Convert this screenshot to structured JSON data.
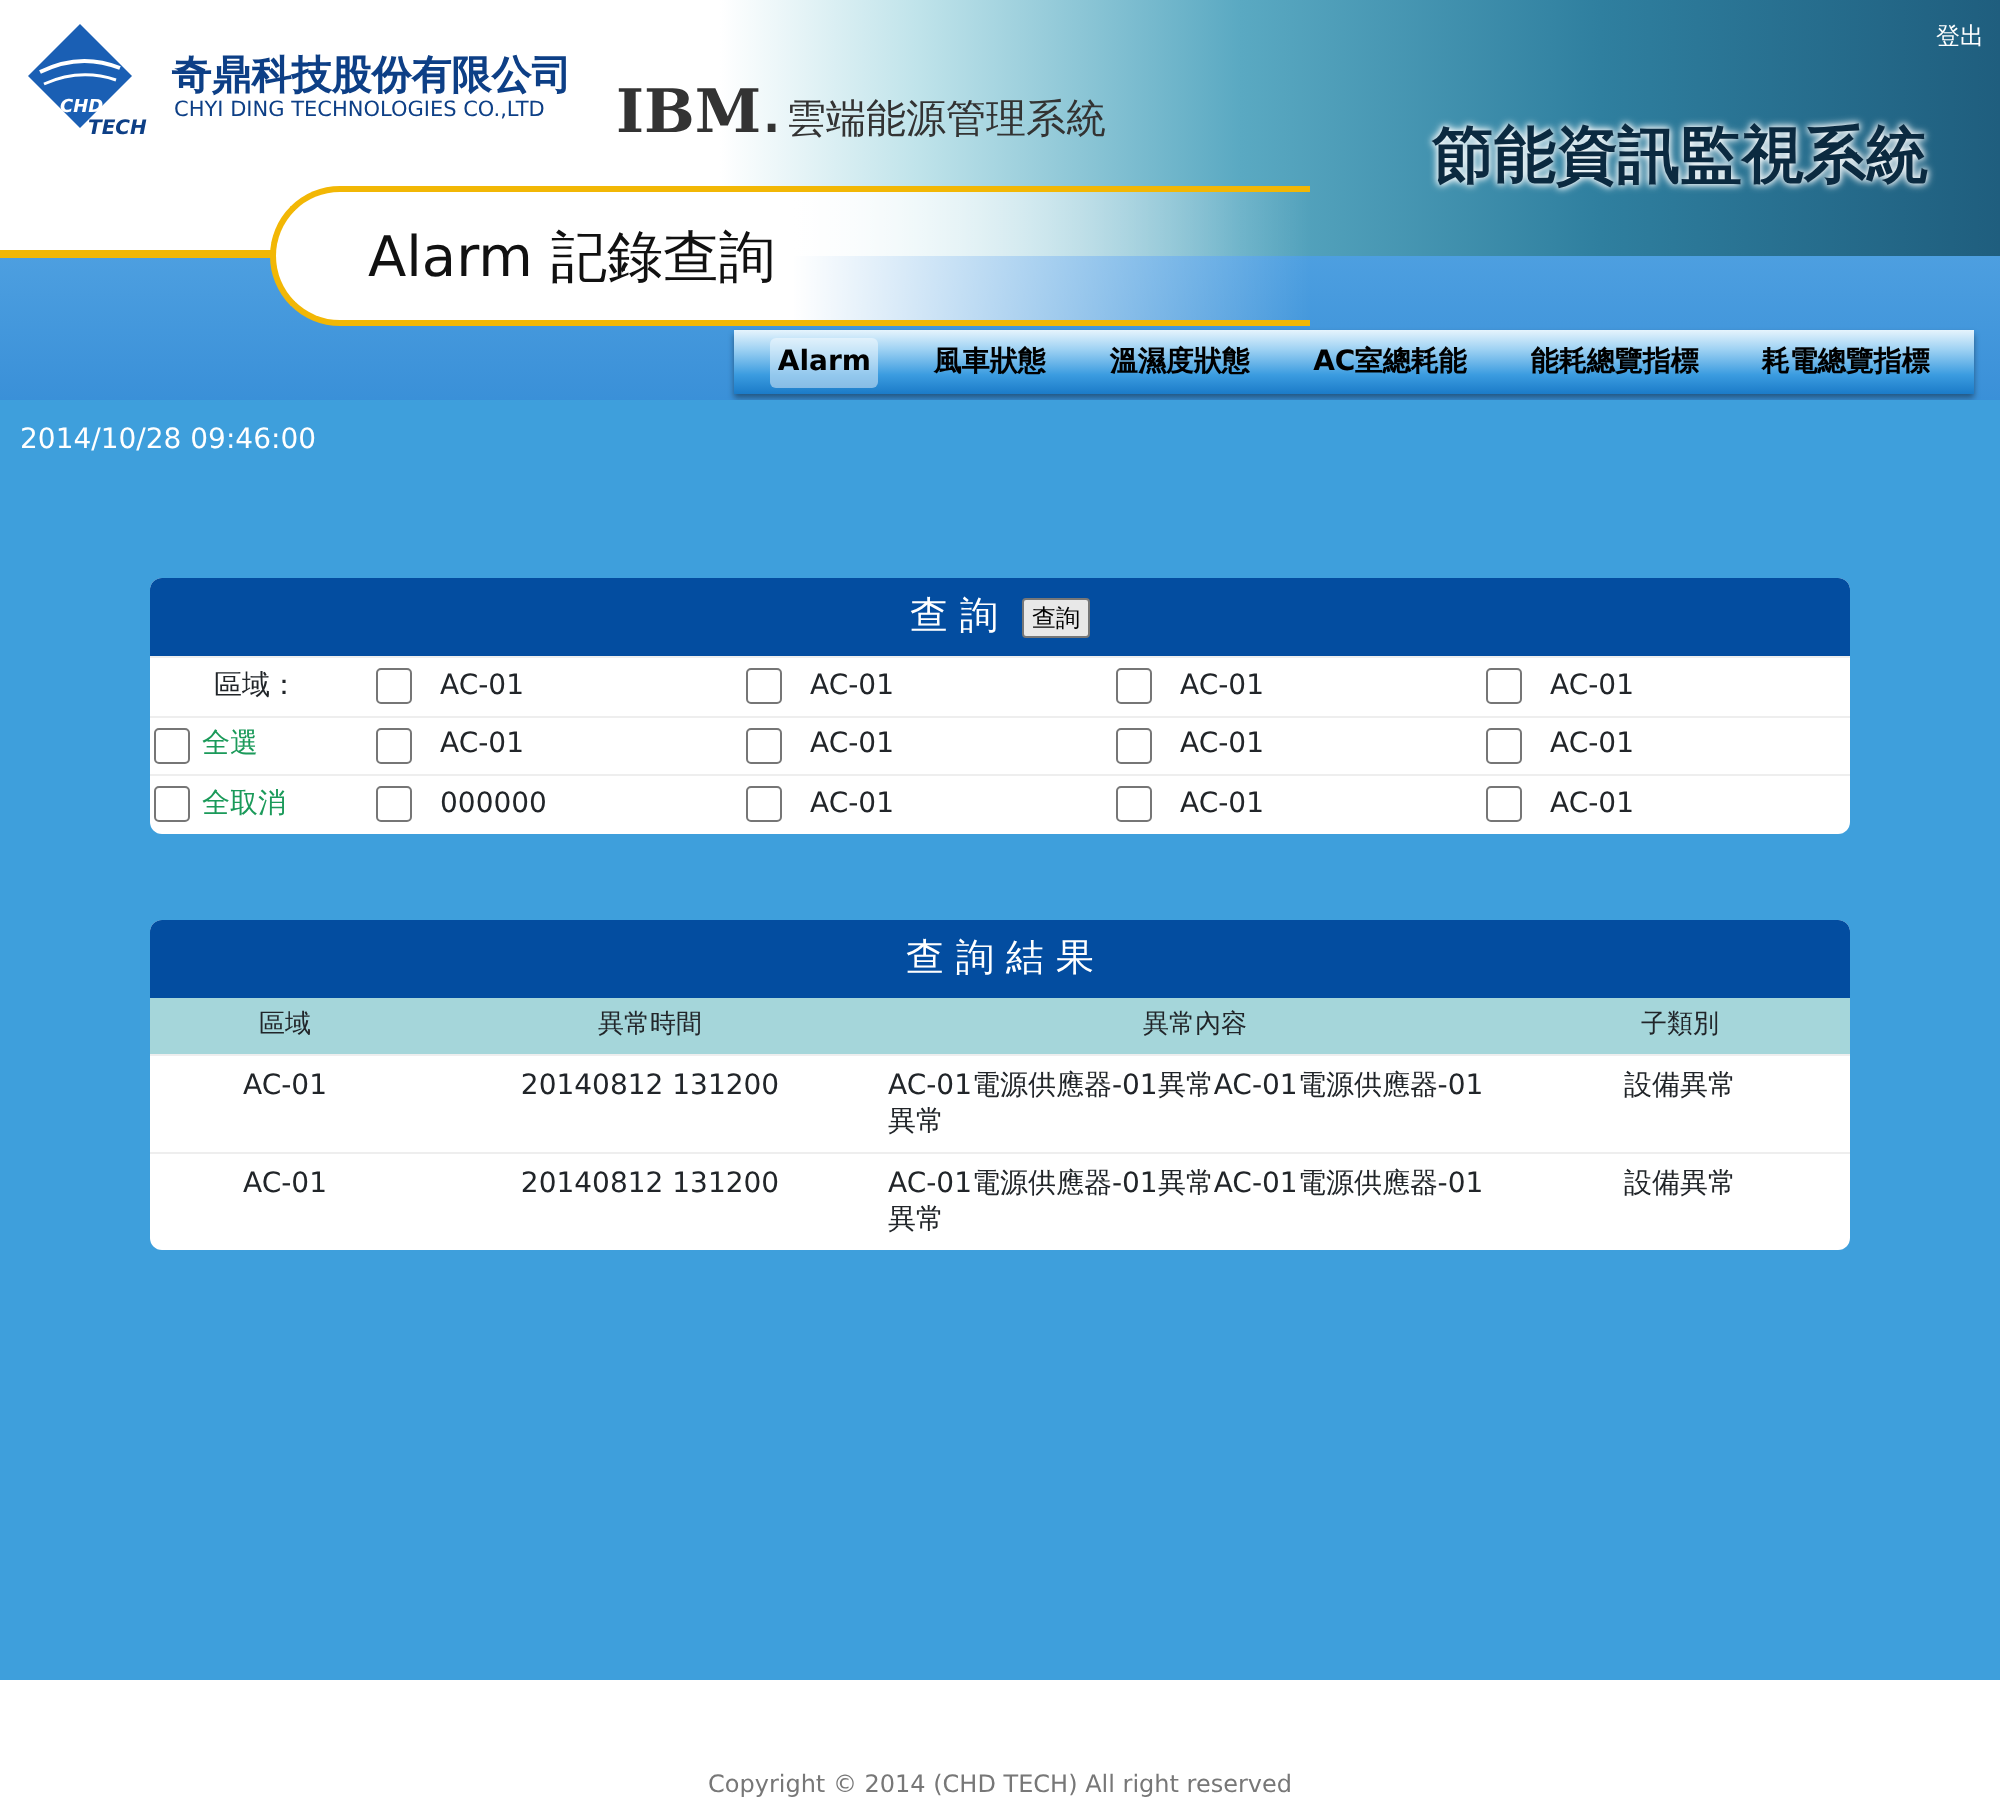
{
  "header": {
    "logo_text": [
      "CHD",
      "TECH"
    ],
    "company_name": "奇鼎科技股份有限公司",
    "company_name_en": "CHYI DING TECHNOLOGIES CO.,LTD",
    "ibm_text": "IBM",
    "ibm_suffix": ".",
    "ibm_system": "雲端能源管理系統",
    "system_title": "節能資訊監視系統",
    "logout": "登出",
    "page_title": "Alarm 記錄查詢"
  },
  "nav": [
    {
      "label": "Alarm",
      "selected": true
    },
    {
      "label": "風車狀態",
      "selected": false
    },
    {
      "label": "溫濕度狀態",
      "selected": false
    },
    {
      "label": "AC室總耗能",
      "selected": false
    },
    {
      "label": "能耗總覽指標",
      "selected": false
    },
    {
      "label": "耗電總覽指標",
      "selected": false
    }
  ],
  "datetime": "2014/10/28 09:46:00",
  "query": {
    "title": "查 詢",
    "button": "查詢",
    "rows": [
      {
        "kind": "label",
        "label": "區域：",
        "areas": [
          {
            "label": "AC-01",
            "checked": false
          },
          {
            "label": "AC-01",
            "checked": false
          },
          {
            "label": "AC-01",
            "checked": false
          },
          {
            "label": "AC-01",
            "checked": false
          }
        ]
      },
      {
        "kind": "checkbox",
        "label": "全選",
        "checked": false,
        "areas": [
          {
            "label": "AC-01",
            "checked": false
          },
          {
            "label": "AC-01",
            "checked": false
          },
          {
            "label": "AC-01",
            "checked": false
          },
          {
            "label": "AC-01",
            "checked": false
          }
        ]
      },
      {
        "kind": "checkbox",
        "label": "全取消",
        "checked": false,
        "areas": [
          {
            "label": "000000",
            "checked": false
          },
          {
            "label": "AC-01",
            "checked": false
          },
          {
            "label": "AC-01",
            "checked": false
          },
          {
            "label": "AC-01",
            "checked": false
          }
        ]
      }
    ]
  },
  "results": {
    "title": "查 詢 結 果",
    "columns": [
      "區域",
      "異常時間",
      "異常內容",
      "子類別"
    ],
    "rows": [
      [
        "AC-01",
        "20140812 131200",
        "AC-01電源供應器-01異常AC-01電源供應器-01異常",
        "設備異常"
      ],
      [
        "AC-01",
        "20140812 131200",
        "AC-01電源供應器-01異常AC-01電源供應器-01異常",
        "設備異常"
      ]
    ]
  },
  "footer": "Copyright © 2014 (CHD TECH) All right reserved"
}
